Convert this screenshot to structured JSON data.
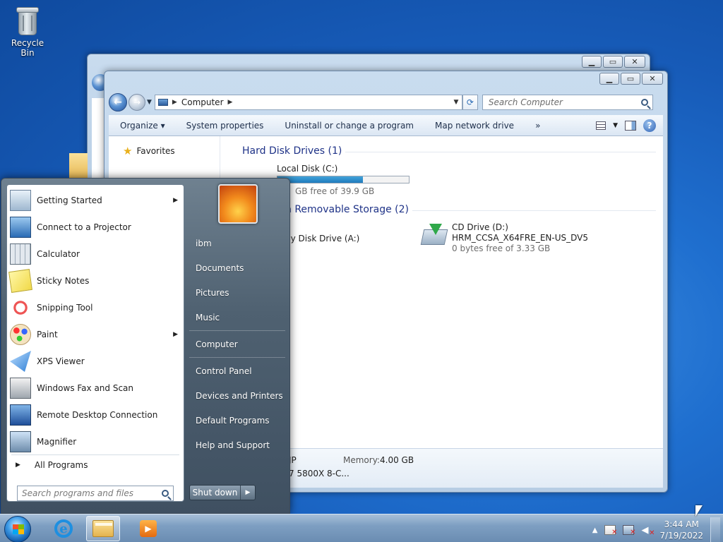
{
  "desktop": {
    "icons": [
      {
        "label": "Recycle Bin",
        "icon": "recycle-bin-icon"
      }
    ]
  },
  "explorer": {
    "address": {
      "segments": [
        "Computer"
      ]
    },
    "search_placeholder": "Search Computer",
    "toolbar": {
      "organize": "Organize",
      "system_properties": "System properties",
      "uninstall": "Uninstall or change a program",
      "map_drive": "Map network drive",
      "more": "»"
    },
    "nav": {
      "favorites": "Favorites"
    },
    "groups": {
      "hdd": "Hard Disk Drives (1)",
      "removable": "h Removable Storage (2)"
    },
    "drives": {
      "c": {
        "name": "Local Disk (C:)",
        "free": "GB free of 39.9 GB",
        "used_fraction": 0.65
      },
      "a": {
        "name": "py Disk Drive (A:)"
      },
      "d": {
        "name": "CD Drive (D:)",
        "label": "HRM_CCSA_X64FRE_EN-US_DV5",
        "free": "0 bytes free of 3.33 GB"
      }
    },
    "details": {
      "memory_label": "Memory:",
      "memory_value": "4.00 GB",
      "left_top": "JP",
      "left_bottom": "7 5800X 8-C..."
    }
  },
  "start_menu": {
    "programs": [
      {
        "label": "Getting Started",
        "icon": "getting-started-icon",
        "submenu": true
      },
      {
        "label": "Connect to a Projector",
        "icon": "projector-icon",
        "submenu": false
      },
      {
        "label": "Calculator",
        "icon": "calculator-icon",
        "submenu": false
      },
      {
        "label": "Sticky Notes",
        "icon": "sticky-notes-icon",
        "submenu": false
      },
      {
        "label": "Snipping Tool",
        "icon": "snipping-tool-icon",
        "submenu": false
      },
      {
        "label": "Paint",
        "icon": "paint-icon",
        "submenu": true
      },
      {
        "label": "XPS Viewer",
        "icon": "xps-viewer-icon",
        "submenu": false
      },
      {
        "label": "Windows Fax and Scan",
        "icon": "fax-scan-icon",
        "submenu": false
      },
      {
        "label": "Remote Desktop Connection",
        "icon": "remote-desktop-icon",
        "submenu": false
      },
      {
        "label": "Magnifier",
        "icon": "magnifier-icon",
        "submenu": false
      }
    ],
    "all_programs": "All Programs",
    "search_placeholder": "Search programs and files",
    "right": {
      "user": "ibm",
      "documents": "Documents",
      "pictures": "Pictures",
      "music": "Music",
      "computer": "Computer",
      "control_panel": "Control Panel",
      "devices": "Devices and Printers",
      "default_programs": "Default Programs",
      "help": "Help and Support"
    },
    "shutdown": "Shut down"
  },
  "taskbar": {
    "time": "3:44 AM",
    "date": "7/19/2022"
  }
}
